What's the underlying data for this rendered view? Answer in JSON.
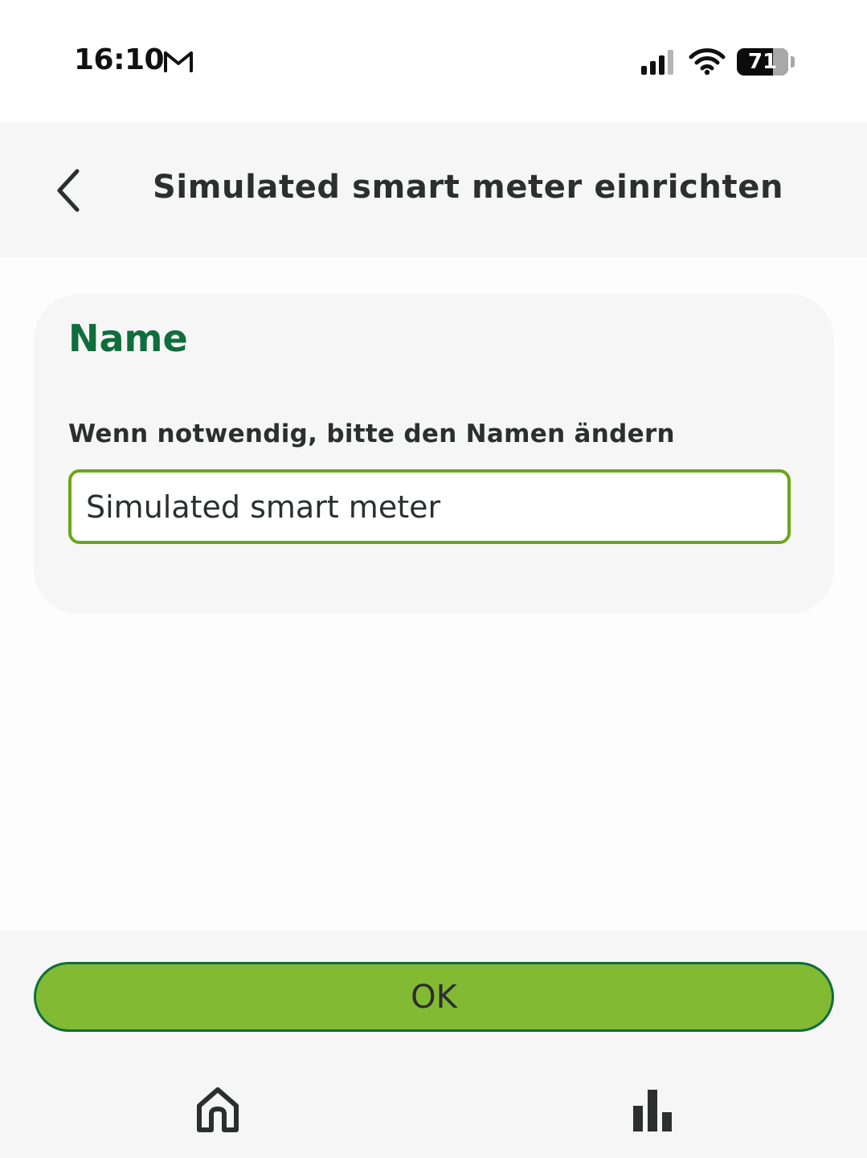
{
  "status_bar": {
    "time": "16:10",
    "notification_icon": "gmail-icon",
    "signal_icon": "cellular-signal-icon",
    "wifi_icon": "wifi-icon",
    "battery_level": "71",
    "battery_fraction": 0.71
  },
  "header": {
    "back_icon": "chevron-left-icon",
    "title": "Simulated smart meter einrichten"
  },
  "card": {
    "title": "Name",
    "field_label": "Wenn notwendig, bitte den Namen ändern",
    "name_value": "Simulated smart meter"
  },
  "footer": {
    "ok_label": "OK"
  },
  "bottom_nav": {
    "items": [
      {
        "icon": "home-icon"
      },
      {
        "icon": "bar-chart-icon"
      }
    ]
  },
  "colors": {
    "accent_green": "#82bb33",
    "dark_green": "#0f6e3c",
    "input_border": "#6aa616",
    "text_dark": "#2b2f2e"
  }
}
